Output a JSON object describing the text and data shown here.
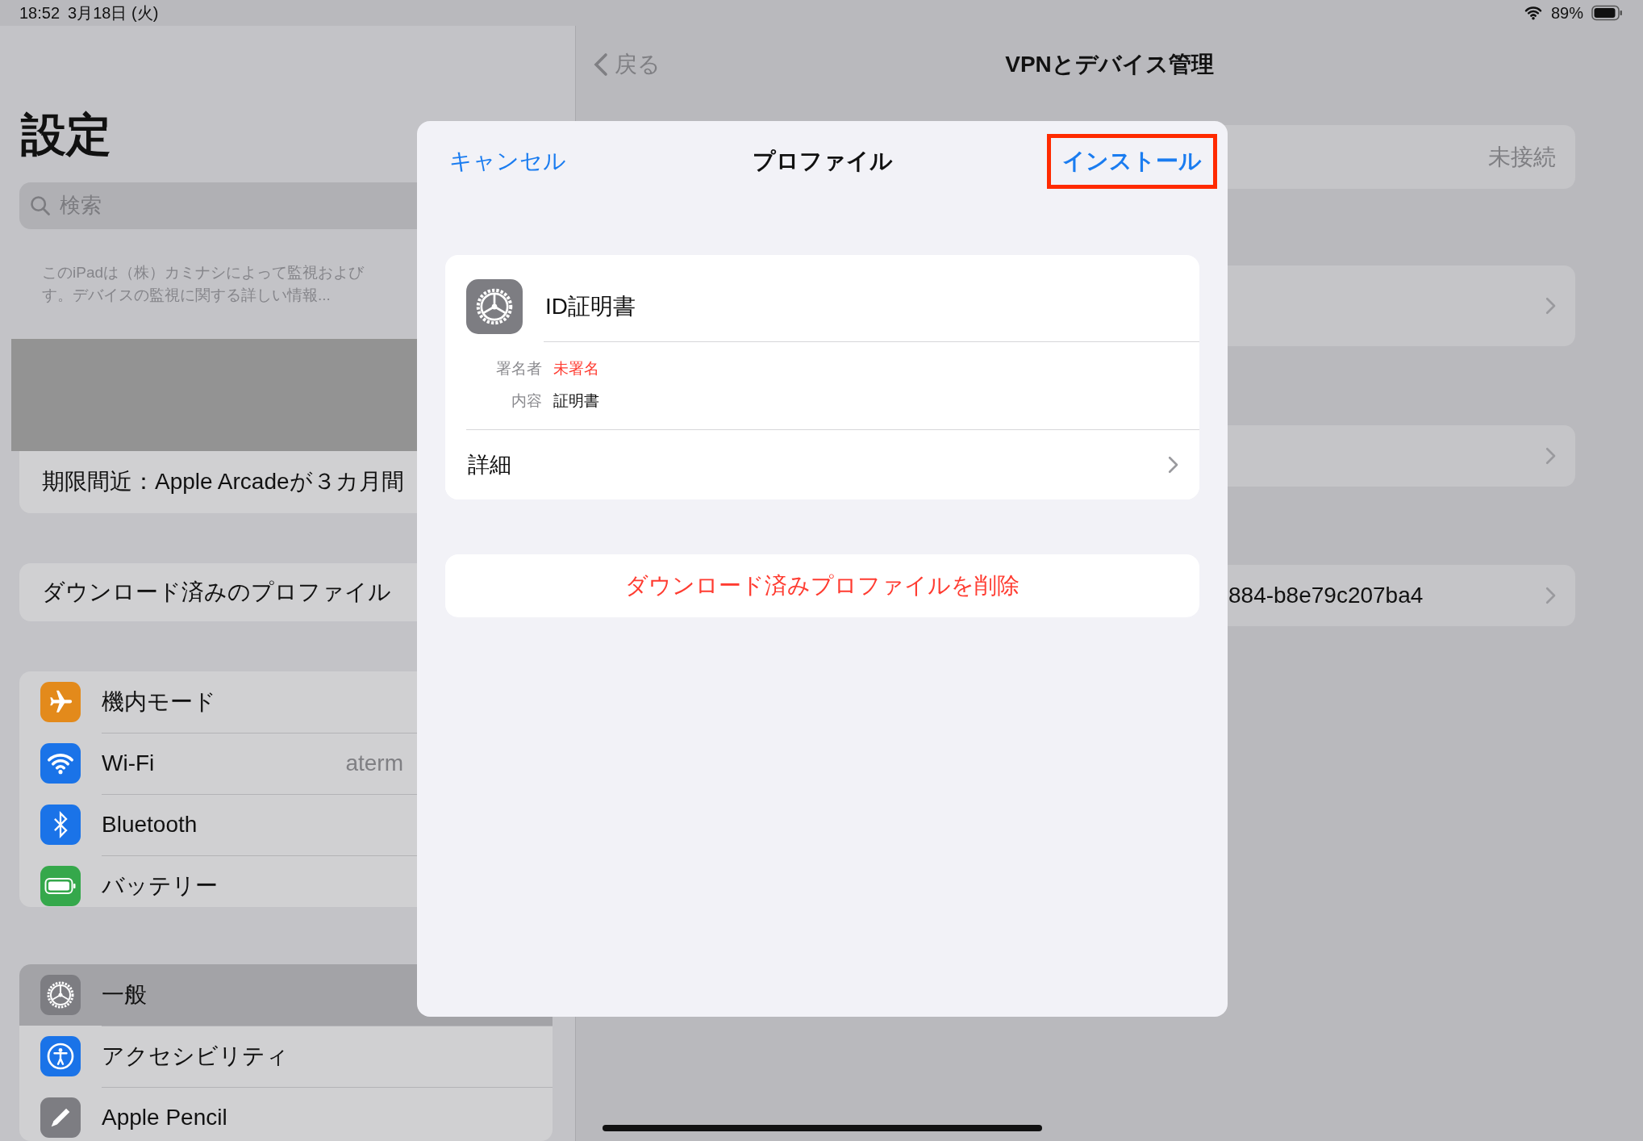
{
  "status_bar": {
    "time": "18:52",
    "date": "3月18日 (火)",
    "battery": "89%"
  },
  "sidebar": {
    "title": "設定",
    "search": {
      "placeholder": "検索"
    },
    "supervision_note": [
      "このiPadは（株）カミナシによって監視および",
      "す。デバイスの監視に関する詳しい情報..."
    ],
    "notice": "期限間近：Apple Arcadeが３カ月間",
    "profile_row": "ダウンロード済みのプロファイル",
    "groups": [
      [
        {
          "label": "機内モード",
          "color": "#e38a1b",
          "selected": false
        },
        {
          "label": "Wi-Fi",
          "value": "aterm",
          "color": "#1a73e8",
          "selected": false
        },
        {
          "label": "Bluetooth",
          "color": "#1a73e8",
          "selected": false
        },
        {
          "label": "バッテリー",
          "color": "#35a84b",
          "selected": false
        }
      ],
      [
        {
          "label": "一般",
          "color": "#7d7d82",
          "selected": true
        },
        {
          "label": "アクセシビリティ",
          "color": "#1a73e8",
          "selected": false
        },
        {
          "label": "Apple Pencil",
          "color": "#7d7d82",
          "selected": false
        }
      ]
    ]
  },
  "detail": {
    "back": "戻る",
    "title": "VPNとデバイス管理",
    "rows": [
      {
        "value": "未接続",
        "chevron": false
      },
      {
        "chevron": true
      },
      {
        "chevron": true
      },
      {
        "label": "884-b8e79c207ba4",
        "chevron": true
      }
    ]
  },
  "modal": {
    "cancel": "キャンセル",
    "title": "プロファイル",
    "install": {
      "label": "インストール",
      "highlighted": true
    },
    "profile": {
      "name": "ID証明書",
      "fields": [
        {
          "label": "署名者",
          "value": "未署名",
          "warning": true
        },
        {
          "label": "内容",
          "value": "証明書",
          "warning": false
        }
      ],
      "more": "詳細"
    },
    "delete": "ダウンロード済みプロファイルを削除"
  }
}
